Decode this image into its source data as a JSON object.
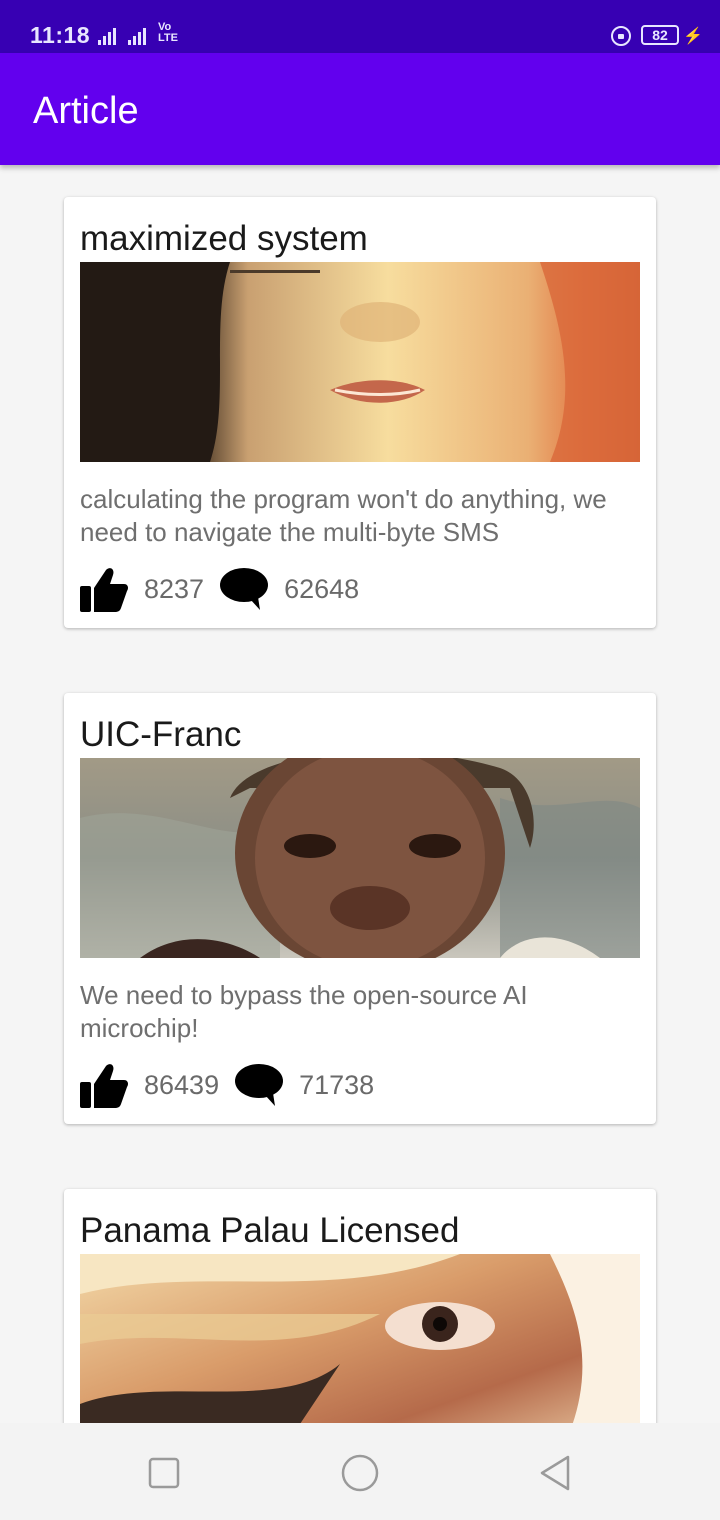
{
  "status_bar": {
    "time": "11:18",
    "volte": "Vo\nLTE",
    "battery": "82"
  },
  "app_bar": {
    "title": "Article"
  },
  "articles": [
    {
      "title": "maximized system",
      "description": "calculating the program won't do anything, we need to navigate the multi-byte SMS",
      "likes": "8237",
      "comments": "62648"
    },
    {
      "title": "UIC-Franc",
      "description": "We need to bypass the open-source AI microchip!",
      "likes": "86439",
      "comments": "71738"
    },
    {
      "title": "Panama Palau Licensed",
      "description": "",
      "likes": "",
      "comments": ""
    }
  ],
  "icons": {
    "like": "thumbs-up-icon",
    "comment": "comment-bubble-icon"
  },
  "colors": {
    "status_bar": "#3700b3",
    "app_bar": "#6200ee",
    "background": "#f5f5f5"
  }
}
